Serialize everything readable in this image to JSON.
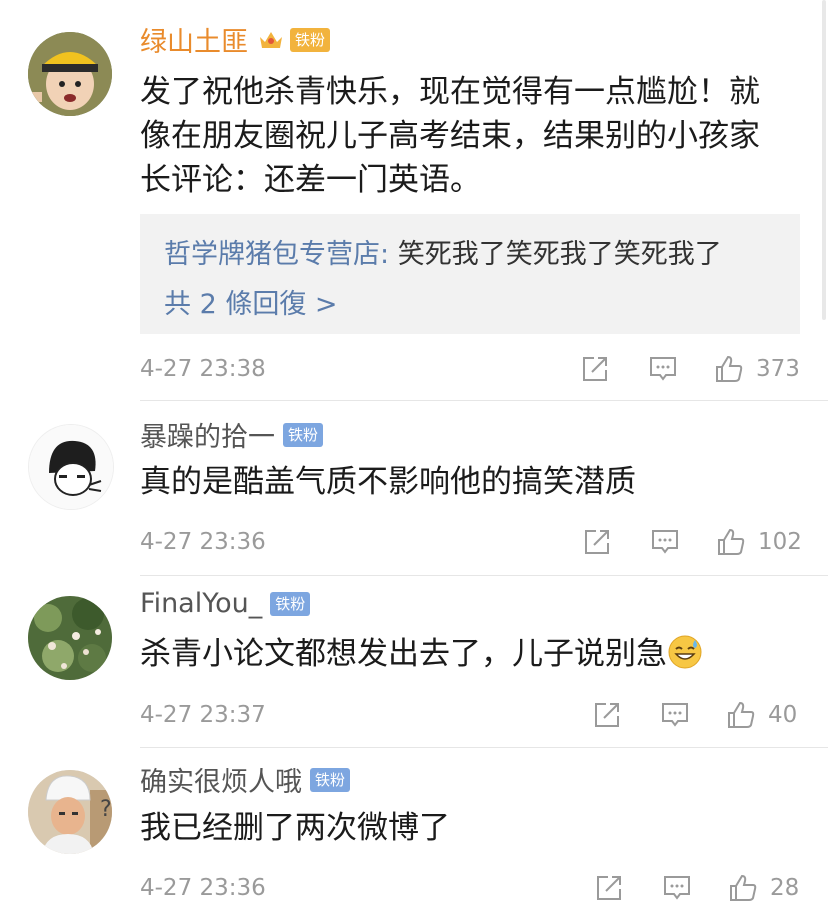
{
  "comments": [
    {
      "username": "绿山土匪",
      "badge": "铁粉",
      "content": "发了祝他杀青快乐，现在觉得有一点尴尬！就像在朋友圈祝儿子高考结束，结果别的小孩家长评论：还差一门英语。",
      "reply": {
        "author": "哲学牌猪包专营店:",
        "text": " 笑死我了笑死我了笑死我了",
        "count_label": "共 2 條回復 >"
      },
      "time": "4-27 23:38",
      "likes": "373"
    },
    {
      "username": "暴躁的拾一",
      "badge": "铁粉",
      "content": "真的是酷盖气质不影响他的搞笑潜质",
      "time": "4-27 23:36",
      "likes": "102"
    },
    {
      "username": "FinalYou_",
      "badge": "铁粉",
      "content": "杀青小论文都想发出去了，儿子说别急",
      "time": "4-27 23:37",
      "likes": "40"
    },
    {
      "username": "确实很烦人哦",
      "badge": "铁粉",
      "content": "我已经删了两次微博了",
      "time": "4-27 23:36",
      "likes": "28"
    }
  ],
  "icons": {
    "repost": "share-box-icon",
    "comment": "comment-bubble-icon",
    "like": "thumbs-up-icon",
    "vip": "crown-icon",
    "emoji": "sweat-smile-emoji"
  },
  "colors": {
    "vip_name": "#e98b2c",
    "reply_link": "#5b7cab",
    "badge_blue": "#7da6e0",
    "badge_gold": "#f2b33d"
  }
}
